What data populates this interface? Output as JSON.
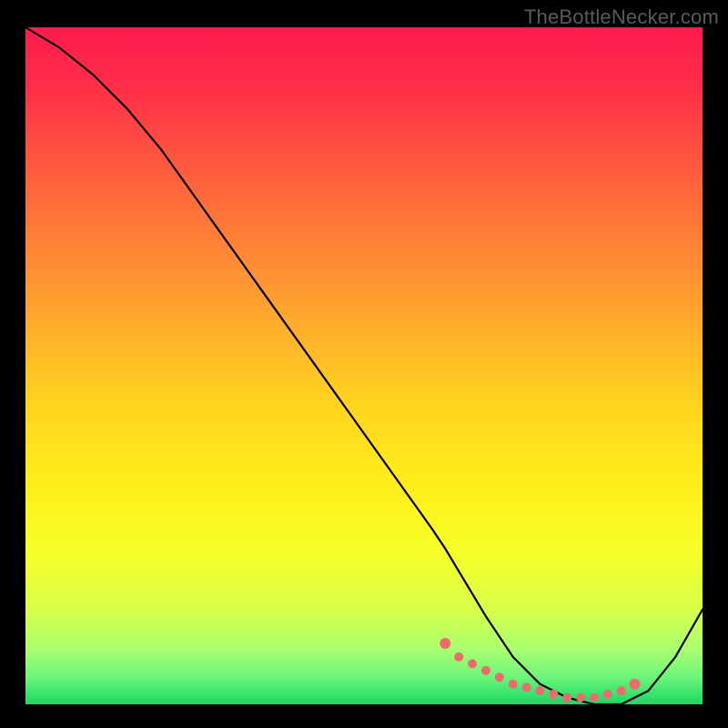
{
  "watermark": "TheBottleNecker.com",
  "chart_data": {
    "type": "line",
    "title": "",
    "xlabel": "",
    "ylabel": "",
    "xlim": [
      0,
      100
    ],
    "ylim": [
      0,
      100
    ],
    "gradient_note": "vertical red→yellow→green background indicating quality from bad (top/red) to good (bottom/green)",
    "curve": {
      "name": "bottleneck-curve",
      "x": [
        0,
        5,
        10,
        15,
        20,
        25,
        30,
        35,
        40,
        45,
        50,
        55,
        60,
        62,
        65,
        68,
        72,
        76,
        80,
        84,
        88,
        92,
        96,
        100
      ],
      "y": [
        100,
        97,
        93,
        88,
        82,
        75,
        68,
        61,
        54,
        47,
        40,
        33,
        26,
        23,
        18,
        13,
        7,
        3,
        1,
        0,
        0,
        2,
        7,
        14
      ]
    },
    "optimal_markers": {
      "name": "optimal-range-dots",
      "x": [
        62,
        64,
        66,
        68,
        70,
        72,
        74,
        76,
        78,
        80,
        82,
        84,
        86,
        88,
        90
      ],
      "y": [
        9,
        7,
        6,
        5,
        4,
        3,
        2.5,
        2,
        1.5,
        1,
        1,
        1,
        1.5,
        2,
        3
      ]
    },
    "background_gradient_stops": [
      {
        "offset": 0.0,
        "color": "#ff1a4f"
      },
      {
        "offset": 0.1,
        "color": "#ff3247"
      },
      {
        "offset": 0.25,
        "color": "#ff6a3a"
      },
      {
        "offset": 0.4,
        "color": "#ff9e30"
      },
      {
        "offset": 0.55,
        "color": "#ffd21f"
      },
      {
        "offset": 0.68,
        "color": "#ffef1a"
      },
      {
        "offset": 0.78,
        "color": "#f5ff2a"
      },
      {
        "offset": 0.86,
        "color": "#d8ff4a"
      },
      {
        "offset": 0.92,
        "color": "#a8ff70"
      },
      {
        "offset": 0.96,
        "color": "#6cf57a"
      },
      {
        "offset": 1.0,
        "color": "#18d964"
      }
    ]
  }
}
